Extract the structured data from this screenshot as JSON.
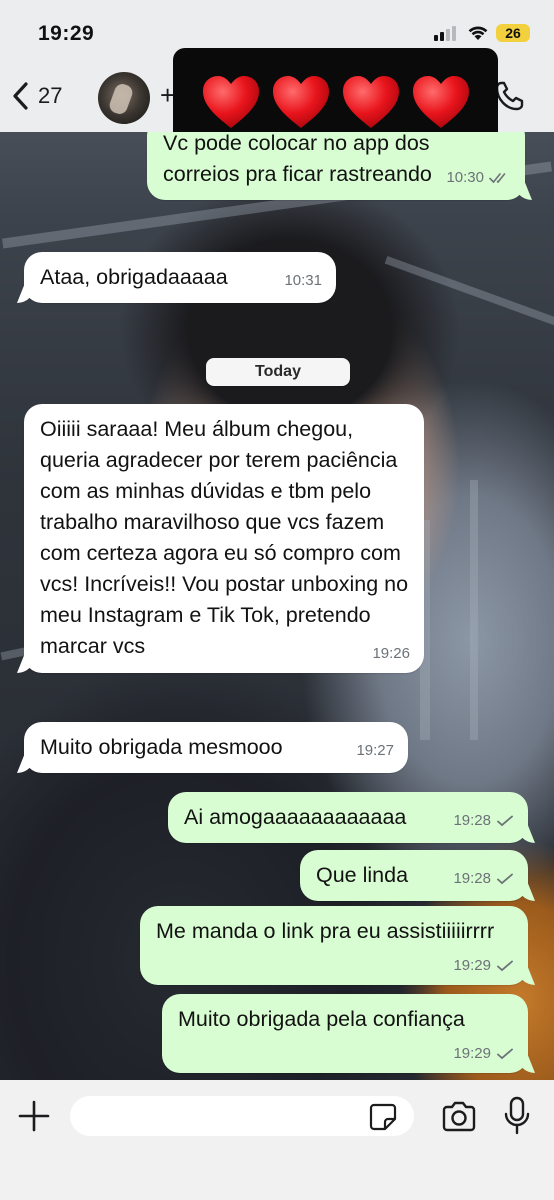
{
  "status_bar": {
    "time": "19:29",
    "battery_level": "26",
    "icons": [
      "signal-icon",
      "wifi-icon",
      "battery-icon"
    ]
  },
  "header": {
    "back_count": "27",
    "back_icon": "chevron-left-icon",
    "header_fragment": "+",
    "call_icon": "phone-icon",
    "censor_hearts": [
      "❤️",
      "❤️",
      "❤️",
      "❤️"
    ]
  },
  "chat": {
    "date_separator": "Today",
    "messages": [
      {
        "direction": "out",
        "text": "Vc pode colocar no app dos correios pra ficar rastreando",
        "time": "10:30",
        "status": "read"
      },
      {
        "direction": "in",
        "text": "Ataa, obrigadaaaaa",
        "time": "10:31"
      },
      {
        "direction": "in",
        "text": "Oiiiii saraaa! Meu álbum chegou, queria agradecer por terem paciência com as minhas dúvidas e tbm pelo trabalho maravilhoso que vcs fazem com certeza agora eu só compro com vcs! Incríveis!! Vou postar unboxing no meu Instagram e Tik Tok, pretendo marcar vcs",
        "time": "19:26"
      },
      {
        "direction": "in",
        "text": "Muito obrigada mesmooo",
        "time": "19:27"
      },
      {
        "direction": "out",
        "text": "Ai amogaaaaaaaaaaaa",
        "time": "19:28",
        "status": "sent"
      },
      {
        "direction": "out",
        "text": "Que linda",
        "time": "19:28",
        "status": "sent"
      },
      {
        "direction": "out",
        "text": "Me manda o link pra eu assistiiiiirrrr",
        "time": "19:29",
        "status": "sent"
      },
      {
        "direction": "out",
        "text": "Muito obrigada pela confiança",
        "time": "19:29",
        "status": "sent"
      }
    ]
  },
  "input_bar": {
    "placeholder": "",
    "icons": [
      "plus-icon",
      "sticker-icon",
      "camera-icon",
      "microphone-icon"
    ]
  },
  "colors": {
    "outgoing_bubble": "#d9fdd3",
    "incoming_bubble": "#ffffff",
    "battery": "#f3d13e",
    "header_bg": "#ebedef"
  }
}
